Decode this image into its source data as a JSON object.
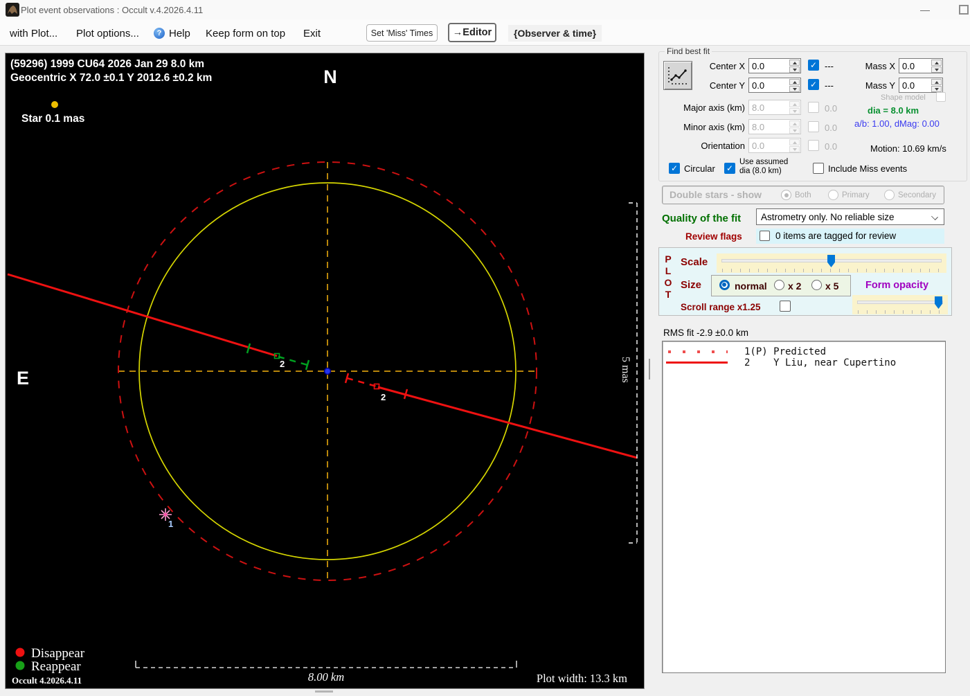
{
  "window": {
    "title": "Plot event observations : Occult v.4.2026.4.11",
    "minimize_icon": "—"
  },
  "icons": {
    "help_qmark": "?",
    "check": "✓"
  },
  "menubar": {
    "with_plot": "with Plot...",
    "plot_options": "Plot options...",
    "help": "Help",
    "keep_form_on_top": "Keep form on top",
    "exit": "Exit",
    "set_miss_times": "Set 'Miss' Times",
    "editor": "→Editor",
    "observer_and_time": "{Observer & time}"
  },
  "fit": {
    "group_label": "Find best fit",
    "center_x_label": "Center X",
    "center_x_value": "0.0",
    "dash_x": "---",
    "center_y_label": "Center Y",
    "center_y_value": "0.0",
    "dash_y": "---",
    "mass_x_label": "Mass X",
    "mass_x_value": "0.0",
    "mass_y_label": "Mass Y",
    "mass_y_value": "0.0",
    "shape_model_label": "Shape model",
    "major_axis_label": "Major axis (km)",
    "major_axis_value": "8.0",
    "major_axis_fit": "0.0",
    "minor_axis_label": "Minor axis (km)",
    "minor_axis_value": "8.0",
    "minor_axis_fit": "0.0",
    "orientation_label": "Orientation",
    "orientation_value": "0.0",
    "orientation_fit": "0.0",
    "dia_label": "dia = 8.0 km",
    "ab_dmag_label": "a/b: 1.00, dMag: 0.00",
    "motion_label": "Motion: 10.69 km/s",
    "circular_label": "Circular",
    "use_assumed_line1": "Use assumed",
    "use_assumed_line2": "dia (8.0 km)",
    "include_miss_label": "Include Miss events"
  },
  "double_stars": {
    "group_label": "Double stars - show",
    "both": "Both",
    "primary": "Primary",
    "secondary": "Secondary"
  },
  "quality": {
    "label": "Quality of the fit",
    "value": "Astrometry only. No reliable size"
  },
  "review": {
    "label": "Review flags",
    "value": "0 items are tagged for review"
  },
  "plot_controls": {
    "letters": [
      "P",
      "L",
      "O",
      "T"
    ],
    "scale_label": "Scale",
    "size_label": "Size",
    "size_normal": "normal",
    "size_x2": "x 2",
    "size_x5": "x 5",
    "form_opacity_label": "Form opacity",
    "scroll_range_label": "Scroll range x1.25"
  },
  "rms": {
    "label": "RMS fit -2.9 ±0.0 km",
    "rows": [
      {
        "num": "1(P)",
        "name": "Predicted"
      },
      {
        "num": "2",
        "name": "Y Liu, near Cupertino"
      }
    ]
  },
  "plot": {
    "header_line1": "(59296) 1999 CU64  2026 Jan 29  8.0 km",
    "header_line2": "Geocentric X 72.0 ±0.1 Y 2012.6 ±0.2 km",
    "north_label": "N",
    "east_label": "E",
    "star_label": "Star 0.1 mas",
    "mas_scale_label": "5 mas",
    "chord_label_left": "2",
    "chord_label_right": "2",
    "site_label": "1",
    "legend": {
      "disappear": "Disappear",
      "reappear": "Reappear"
    },
    "version": "Occult 4.2026.4.11",
    "scalebar_label": "8.00 km",
    "plot_width_label": "Plot width: 13.3 km",
    "colors": {
      "asteroid_circle": "#d6d600",
      "predicted_circle": "#cc1111",
      "crosshair": "#b8860b",
      "chord": "#ee1111",
      "shift_segment": "#00a020",
      "center_dot": "#2233ee",
      "star_dot": "#edbe00",
      "site_marker": "#ff9ed2",
      "accent": "#0078d7"
    }
  }
}
